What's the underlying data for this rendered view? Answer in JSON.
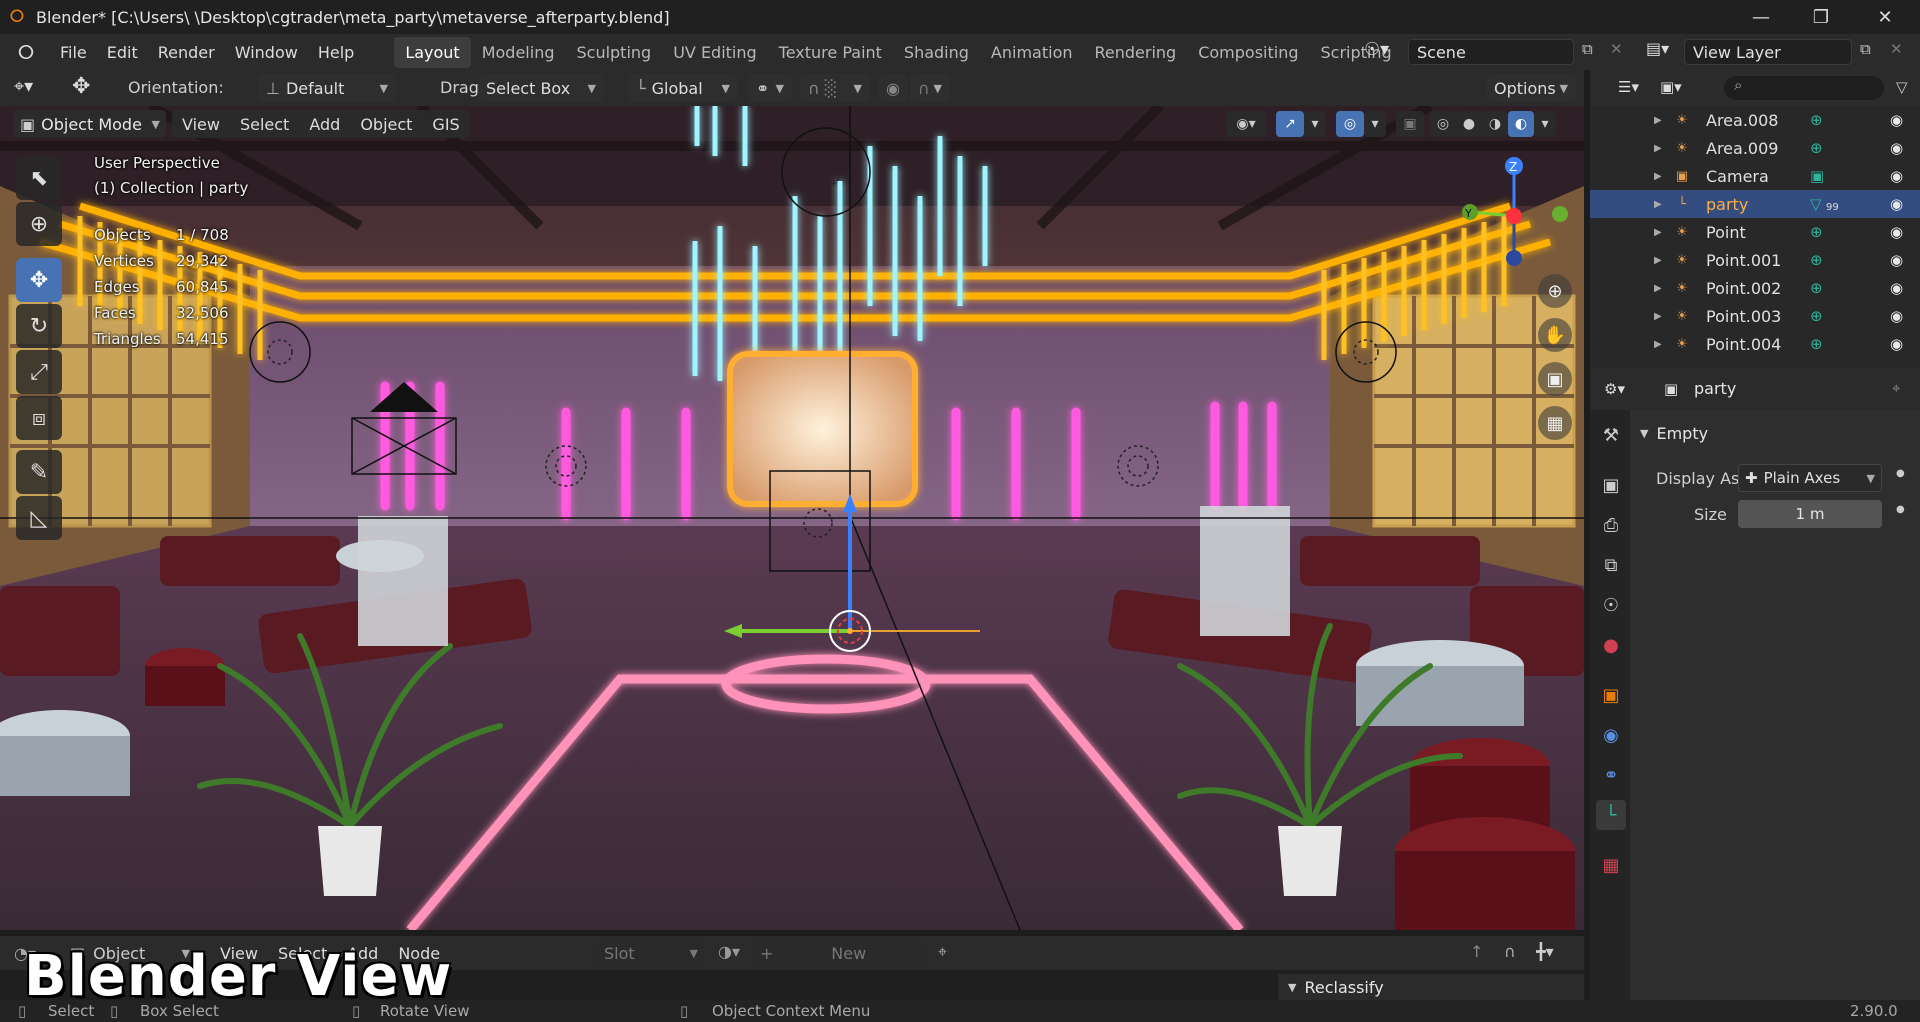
{
  "title_bar": {
    "title": "Blender* [C:\\Users\\        \\Desktop\\cgtrader\\meta_party\\metaverse_afterparty.blend]",
    "minimize": "—",
    "maximize": "❐",
    "close": "✕"
  },
  "menu": [
    "File",
    "Edit",
    "Render",
    "Window",
    "Help"
  ],
  "workspaces": [
    "Layout",
    "Modeling",
    "Sculpting",
    "UV Editing",
    "Texture Paint",
    "Shading",
    "Animation",
    "Rendering",
    "Compositing",
    "Scripting"
  ],
  "active_workspace": "Layout",
  "add_workspace": "+",
  "scene": {
    "label": "Scene"
  },
  "view_layer": {
    "label": "View Layer"
  },
  "tool_header": {
    "orientation_label": "Orientation:",
    "orientation_value": "Default",
    "drag_label": "Drag:",
    "drag_value": "Select Box",
    "transform_space": "Global",
    "options": "Options"
  },
  "viewport_header": {
    "mode": "Object Mode",
    "menus": [
      "View",
      "Select",
      "Add",
      "Object",
      "GIS"
    ]
  },
  "overlay": {
    "perspective": "User Perspective",
    "collection": "(1) Collection | party",
    "stats": [
      {
        "label": "Objects",
        "value": "1 / 708"
      },
      {
        "label": "Vertices",
        "value": "29,342"
      },
      {
        "label": "Edges",
        "value": "60,845"
      },
      {
        "label": "Faces",
        "value": "32,506"
      },
      {
        "label": "Triangles",
        "value": "54,415"
      }
    ]
  },
  "gizmo": {
    "z": "Z",
    "y": "Y"
  },
  "outliner": {
    "items": [
      {
        "name": "Area.008",
        "icon": "light-icon",
        "selected": false
      },
      {
        "name": "Area.009",
        "icon": "light-icon",
        "selected": false
      },
      {
        "name": "Camera",
        "icon": "camera-icon",
        "selected": false
      },
      {
        "name": "party",
        "icon": "empty-axes-icon",
        "selected": true,
        "badge": "99"
      },
      {
        "name": "Point",
        "icon": "light-icon",
        "selected": false
      },
      {
        "name": "Point.001",
        "icon": "light-icon",
        "selected": false
      },
      {
        "name": "Point.002",
        "icon": "light-icon",
        "selected": false
      },
      {
        "name": "Point.003",
        "icon": "light-icon",
        "selected": false
      },
      {
        "name": "Point.004",
        "icon": "light-icon",
        "selected": false
      }
    ]
  },
  "properties": {
    "object_name": "party",
    "panel": "Empty",
    "display_as_label": "Display As",
    "display_as_value": "Plain Axes",
    "size_label": "Size",
    "size_value": "1 m"
  },
  "node_header": {
    "editor": "Object",
    "menus": [
      "View",
      "Select",
      "Add",
      "Node"
    ],
    "slot": "Slot",
    "new": "New"
  },
  "node_panel": {
    "label": "Reclassify"
  },
  "status": {
    "select": "Select",
    "box_select": "Box Select",
    "rotate_view": "Rotate View",
    "context_menu": "Object Context Menu",
    "version": "2.90.0"
  },
  "watermark": "Blender View",
  "colors": {
    "accent_blue": "#4772b3",
    "selection_blue": "#334d80",
    "blender_orange": "#e87d0d",
    "neon_yellow": "#ffb000",
    "neon_pink": "#ff4fd8",
    "neon_cyan": "#8ff0ff",
    "floor_lines": "#ff8fb0"
  }
}
